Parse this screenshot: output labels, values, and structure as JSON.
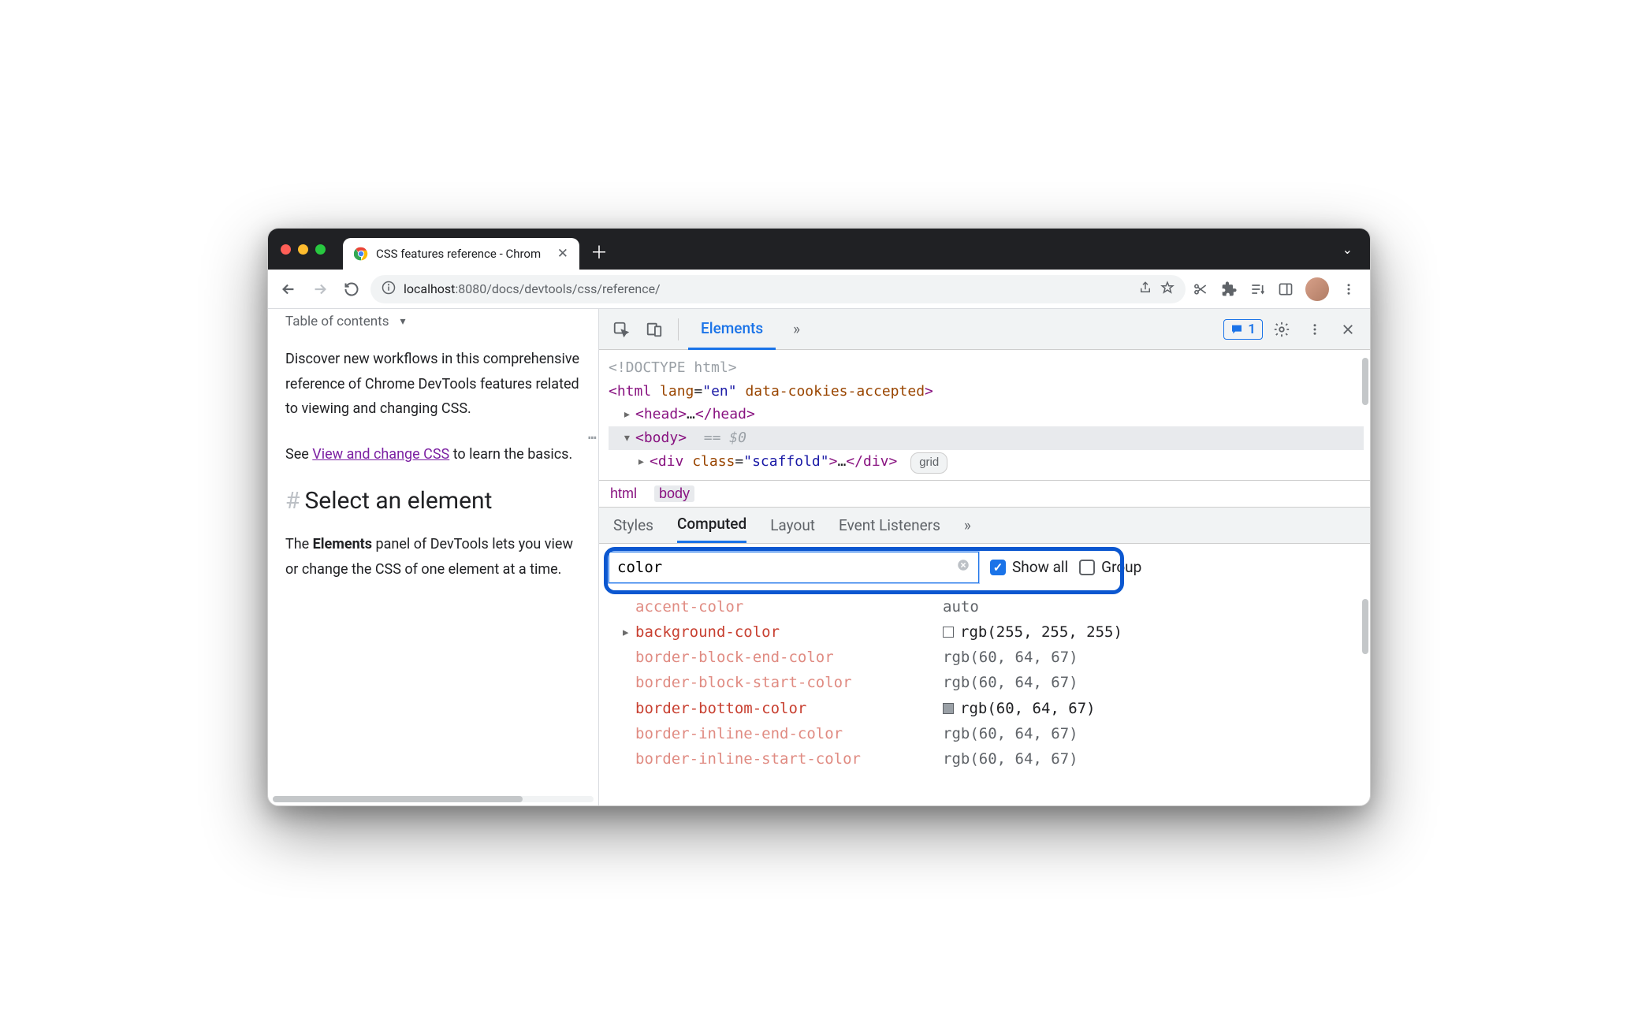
{
  "browser": {
    "tab_title": "CSS features reference - Chrom",
    "url_host": "localhost",
    "url_port": ":8080",
    "url_path": "/docs/devtools/css/reference/"
  },
  "page": {
    "toc_label": "Table of contents",
    "p1": "Discover new workflows in this comprehensive reference of Chrome DevTools features related to viewing and changing CSS.",
    "p2a": "See ",
    "p2_link": "View and change CSS",
    "p2b": " to learn the basics.",
    "h2": "Select an element",
    "p3a": "The ",
    "p3_strong": "Elements",
    "p3b": " panel of DevTools lets you view or change the CSS of one element at a time."
  },
  "devtools": {
    "tabs": {
      "elements": "Elements",
      "more": "»",
      "msg_count": "1"
    },
    "dom": {
      "doctype": "<!DOCTYPE html>",
      "html_open": "html",
      "html_attr1_name": "lang",
      "html_attr1_val": "\"en\"",
      "html_attr2_name": "data-cookies-accepted",
      "head": "head",
      "body": "body",
      "eq": "== $0",
      "div": "div",
      "div_attr_name": "class",
      "div_attr_val": "\"scaffold\"",
      "grid_badge": "grid"
    },
    "crumb": {
      "a": "html",
      "b": "body"
    },
    "subtabs": {
      "styles": "Styles",
      "computed": "Computed",
      "layout": "Layout",
      "events": "Event Listeners",
      "more": "»"
    },
    "filter": {
      "value": "color",
      "showall": "Show all",
      "group": "Group"
    },
    "computed": [
      {
        "name": "accent-color",
        "value": "auto",
        "dim": true
      },
      {
        "name": "background-color",
        "value": "rgb(255, 255, 255)",
        "expandable": true,
        "swatch": "white",
        "strong": true
      },
      {
        "name": "border-block-end-color",
        "value": "rgb(60, 64, 67)",
        "dim": true
      },
      {
        "name": "border-block-start-color",
        "value": "rgb(60, 64, 67)",
        "dim": true
      },
      {
        "name": "border-bottom-color",
        "value": "rgb(60, 64, 67)",
        "swatch": "gray",
        "strong": true
      },
      {
        "name": "border-inline-end-color",
        "value": "rgb(60, 64, 67)",
        "dim": true
      },
      {
        "name": "border-inline-start-color",
        "value": "rgb(60, 64, 67)",
        "dim": true
      }
    ]
  }
}
